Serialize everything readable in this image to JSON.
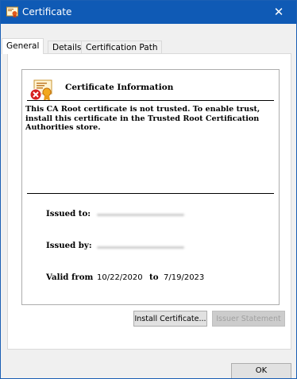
{
  "window": {
    "title": "Certificate",
    "close_glyph": "✕",
    "title_icon": "certificate-icon"
  },
  "tabs": [
    {
      "label": "General",
      "active": true
    },
    {
      "label": "Details",
      "active": false
    },
    {
      "label": "Certification Path",
      "active": false
    }
  ],
  "general": {
    "heading": "Certificate Information",
    "icon": "certificate-error-icon",
    "warning": "This CA Root certificate is not trusted. To enable trust, install this certificate in the Trusted Root Certification Authorities store.",
    "issued_to_label": "Issued to:",
    "issued_by_label": "Issued by:",
    "valid_from_label": "Valid from",
    "valid_from": "10/22/2020",
    "to_label": "to",
    "valid_to": "7/19/2023"
  },
  "buttons": {
    "install": "Install Certificate...",
    "issuer_statement": "Issuer Statement",
    "ok": "OK"
  },
  "colors": {
    "titlebar": "#0f5ab5",
    "window_bg": "#f0f0f0"
  }
}
